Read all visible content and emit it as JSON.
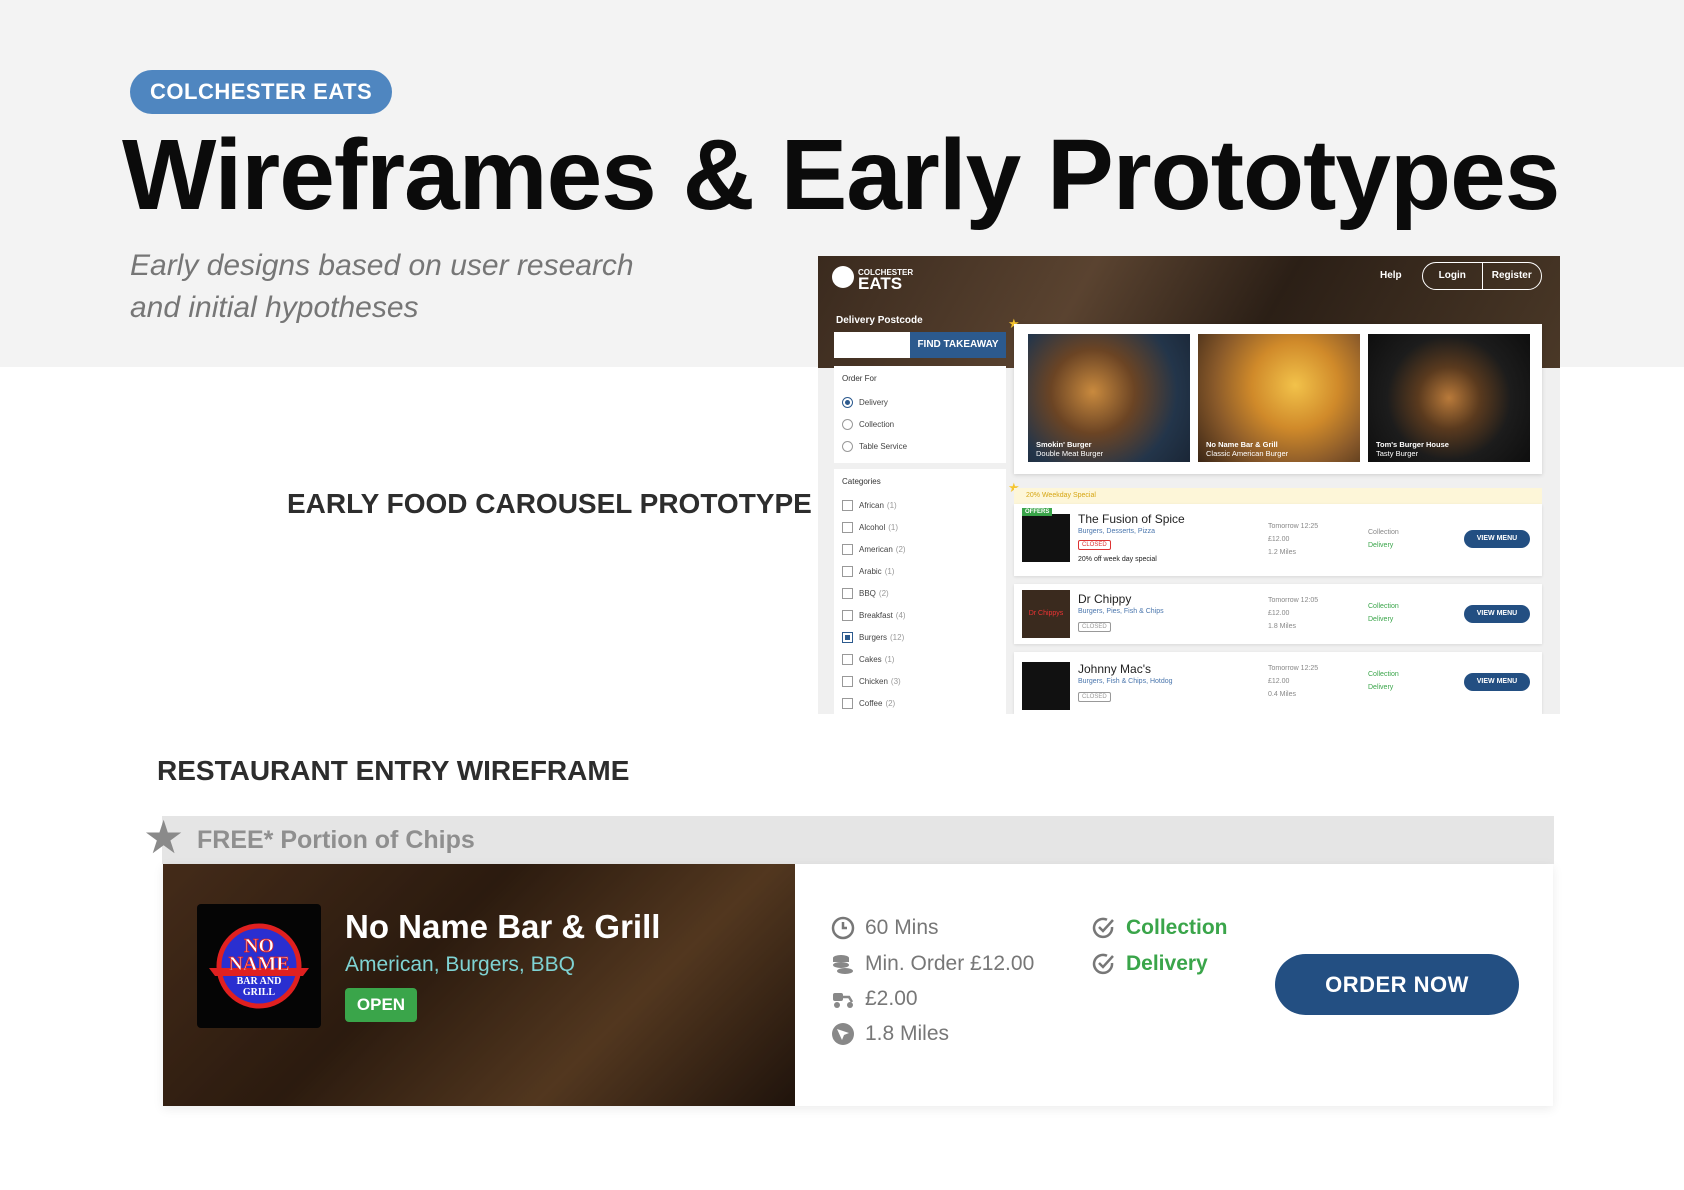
{
  "brand_pill": "COLCHESTER EATS",
  "title": "Wireframes & Early Prototypes",
  "subtitle": "Early designs based on user research and initial hypotheses",
  "labels": {
    "carousel": "EARLY FOOD CAROUSEL PROTOTYPE",
    "entry": "RESTAURANT ENTRY WIREFRAME"
  },
  "shot": {
    "logo_small": "COLCHESTER",
    "logo_big": "EATS",
    "help": "Help",
    "login": "Login",
    "register": "Register",
    "postcode_label": "Delivery Postcode",
    "find_button": "FIND TAKEAWAY",
    "order_for": {
      "heading": "Order For",
      "options": [
        "Delivery",
        "Collection",
        "Table Service"
      ]
    },
    "categories": {
      "heading": "Categories",
      "items": [
        {
          "name": "African",
          "count": "(1)"
        },
        {
          "name": "Alcohol",
          "count": "(1)"
        },
        {
          "name": "American",
          "count": "(2)"
        },
        {
          "name": "Arabic",
          "count": "(1)"
        },
        {
          "name": "BBQ",
          "count": "(2)"
        },
        {
          "name": "Breakfast",
          "count": "(4)"
        },
        {
          "name": "Burgers",
          "count": "(12)"
        },
        {
          "name": "Cakes",
          "count": "(1)"
        },
        {
          "name": "Chicken",
          "count": "(3)"
        },
        {
          "name": "Coffee",
          "count": "(2)"
        }
      ]
    },
    "carousel": [
      {
        "name": "Smokin' Burger",
        "dish": "Double Meat Burger"
      },
      {
        "name": "No Name Bar & Grill",
        "dish": "Classic American Burger"
      },
      {
        "name": "Tom's Burger House",
        "dish": "Tasty Burger"
      }
    ],
    "special": "20% Weekday Special",
    "restaurants": [
      {
        "name": "The Fusion of Spice",
        "cuisine": "Burgers, Desserts, Pizza",
        "status": "CLOSED",
        "offer_tag": "OFFERS",
        "deal": "20% off week day special",
        "time": "Tomorrow 12:25",
        "min": "£12.00",
        "dist": "1.2 Miles",
        "collection": "Collection",
        "delivery": "Delivery",
        "button": "VIEW MENU"
      },
      {
        "name": "Dr Chippy",
        "cuisine": "Burgers, Pies, Fish & Chips",
        "status": "CLOSED",
        "time": "Tomorrow 12:05",
        "min": "£12.00",
        "dist": "1.8 Miles",
        "collection": "Collection",
        "delivery": "Delivery",
        "button": "VIEW MENU",
        "thumb_text": "Dr Chippys"
      },
      {
        "name": "Johnny Mac's",
        "cuisine": "Burgers, Fish & Chips, Hotdog",
        "status": "CLOSED",
        "time": "Tomorrow 12:25",
        "min": "£12.00",
        "dist": "0.4 Miles",
        "collection": "Collection",
        "delivery": "Delivery",
        "button": "VIEW MENU"
      }
    ]
  },
  "entry": {
    "promo": "FREE* Portion of Chips",
    "name": "No Name Bar & Grill",
    "cuisine": "American, Burgers, BBQ",
    "status": "OPEN",
    "logo_text": [
      "NO",
      "NAME",
      "BAR AND",
      "GRILL"
    ],
    "time": "60 Mins",
    "min_order": "Min. Order £12.00",
    "delivery_fee": "£2.00",
    "distance": "1.8 Miles",
    "collection": "Collection",
    "delivery": "Delivery",
    "order_button": "ORDER NOW"
  },
  "colors": {
    "pill": "#4f86c0",
    "navy": "#234f82",
    "green": "#3aa54a",
    "cuisine_teal": "#7fd3d3"
  }
}
